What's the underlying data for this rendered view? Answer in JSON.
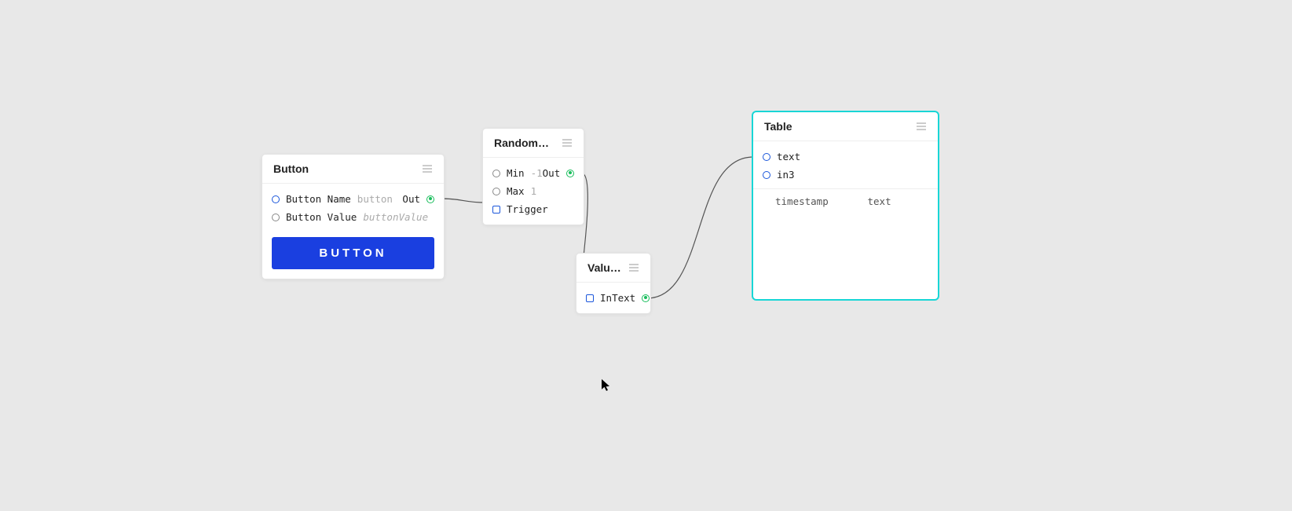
{
  "nodes": {
    "button": {
      "title": "Button",
      "ports": {
        "name": {
          "label": "Button Name",
          "value": "button"
        },
        "value": {
          "label": "Button Value",
          "value": "buttonValue"
        },
        "out": {
          "label": "Out"
        }
      },
      "action_label": "BUTTON"
    },
    "random": {
      "title": "RandomNum...",
      "ports": {
        "min": {
          "label": "Min",
          "value": "-1"
        },
        "max": {
          "label": "Max",
          "value": "1"
        },
        "trigger": {
          "label": "Trigger"
        },
        "out": {
          "label": "Out"
        }
      }
    },
    "value": {
      "title": "Value...",
      "ports": {
        "in": {
          "label": "In"
        },
        "text": {
          "label": "Text"
        }
      }
    },
    "table": {
      "title": "Table",
      "ports": {
        "text": {
          "label": "text"
        },
        "in3": {
          "label": "in3"
        }
      },
      "columns": [
        "timestamp",
        "text"
      ]
    }
  }
}
